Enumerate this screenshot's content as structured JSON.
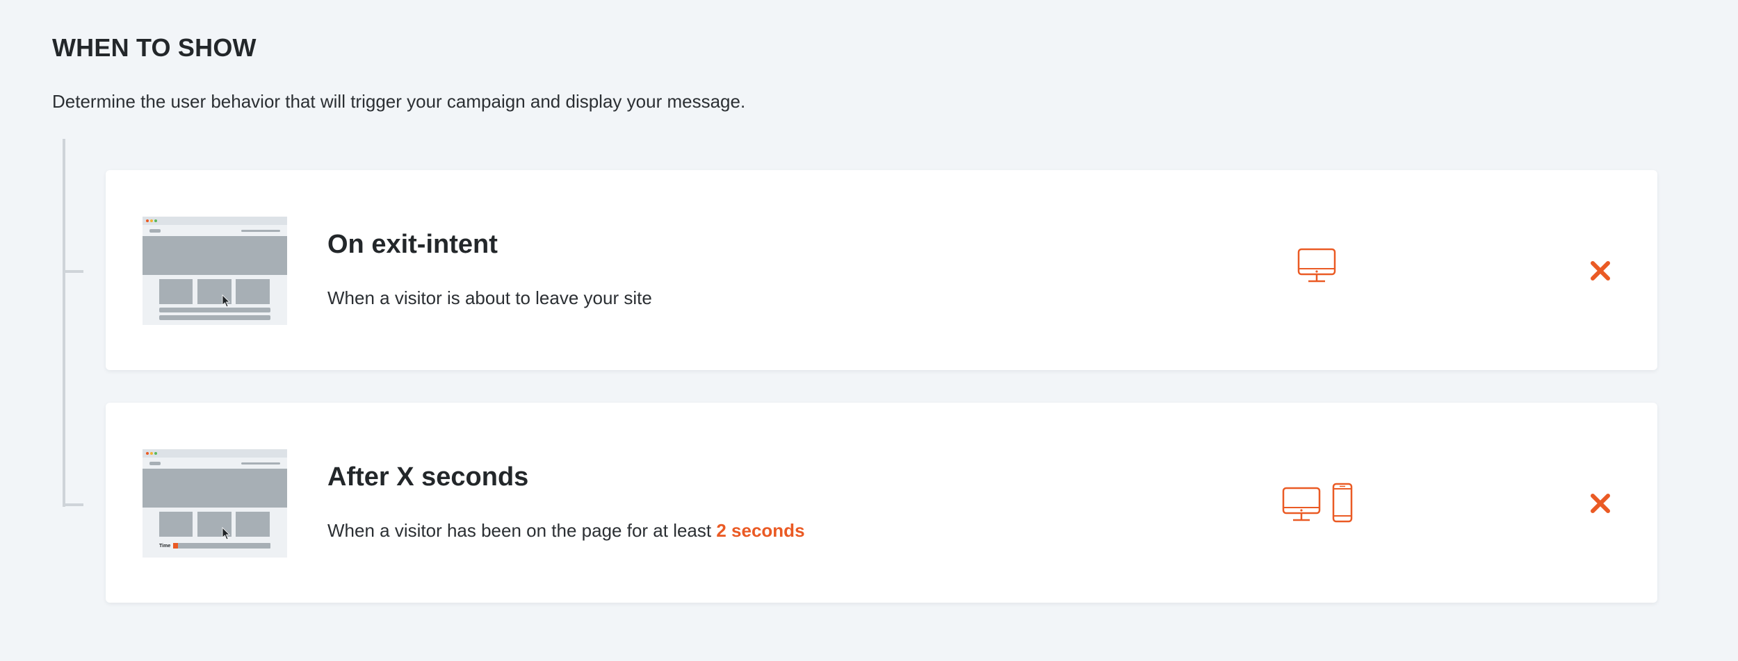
{
  "section": {
    "title": "WHEN TO SHOW",
    "description": "Determine the user behavior that will trigger your campaign and display your message."
  },
  "accent_color": "#ea5a24",
  "cards": [
    {
      "title": "On exit-intent",
      "description": "When a visitor is about to leave your site",
      "devices": [
        "desktop-icon"
      ],
      "thumbnail": "exit-intent-illustration"
    },
    {
      "title": "After X seconds",
      "description": "When a visitor has been on the page for at least",
      "highlight": "2 seconds",
      "thumbnail_label": "Time",
      "devices": [
        "desktop-icon",
        "mobile-icon"
      ],
      "thumbnail": "timer-illustration"
    }
  ]
}
